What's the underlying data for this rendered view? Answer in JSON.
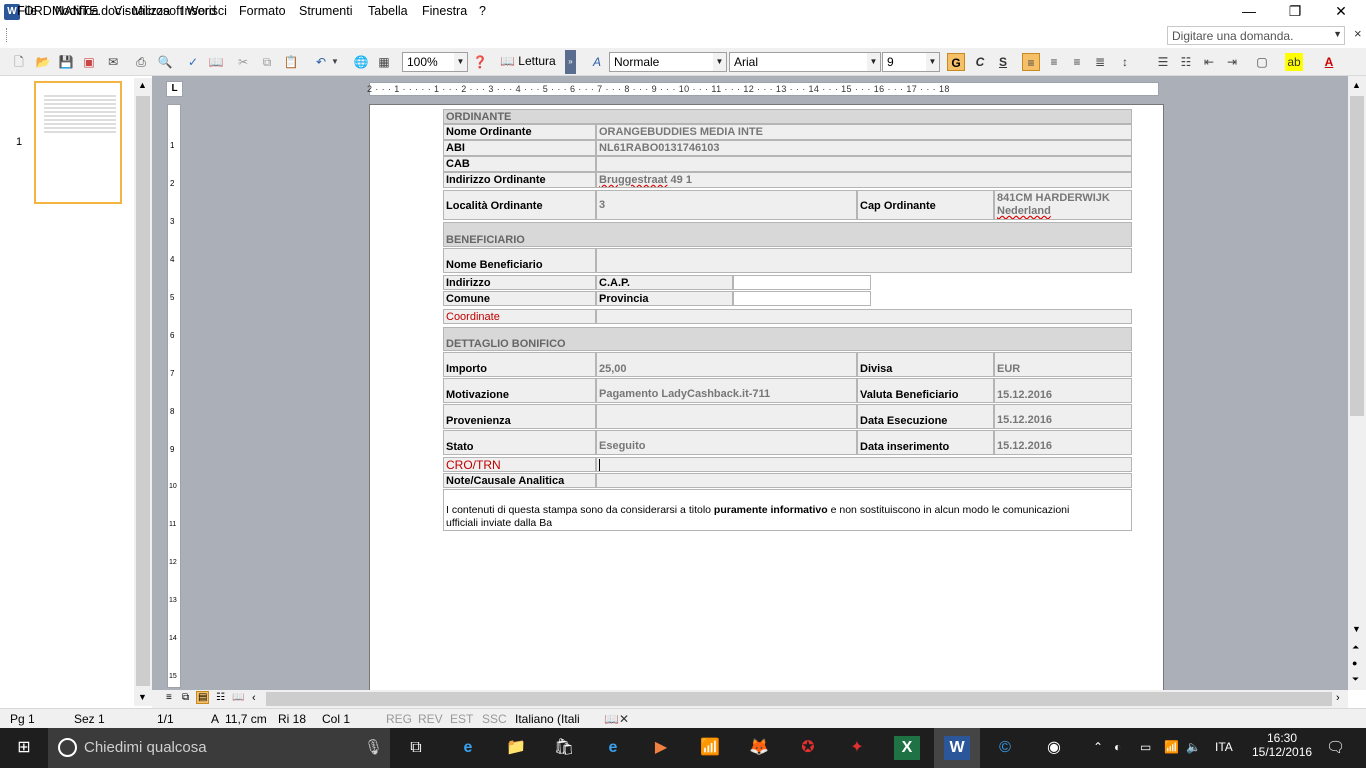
{
  "window": {
    "title": "ORDINANTE.doc - Microsoft Word",
    "icon_letter": "W",
    "minimize": "—",
    "restore": "❐",
    "close": "✕"
  },
  "menu": {
    "items": [
      "File",
      "Modifica",
      "Visualizza",
      "Inserisci",
      "Formato",
      "Strumenti",
      "Tabella",
      "Finestra",
      "?"
    ],
    "ask_placeholder": "Digitare una domanda.",
    "close_doc": "×"
  },
  "toolbar": {
    "zoom": "100%",
    "reading": "Lettura",
    "style": "Normale",
    "font": "Arial",
    "size": "9",
    "bold": "G",
    "italic": "C",
    "underline": "S"
  },
  "ruler": {
    "marks": "2 · · · 1 · · · · · 1 · · · 2 · · · 3 · · · 4 · · · 5 · · · 6 · · · 7 · · · 8 · · · 9 · · · 10 · · · 11 · · · 12 · · · 13 · · · 14 · · · 15 · · · 16 · · · 17 · · · 18",
    "tab_selector": "L",
    "vertical_marks": [
      "1",
      "1",
      "2",
      "3",
      "4",
      "5",
      "6",
      "7",
      "8",
      "9",
      "10",
      "11",
      "12",
      "13",
      "14",
      "15"
    ]
  },
  "thumbnails": {
    "page_number": "1"
  },
  "document": {
    "ordinante_header": "ORDINANTE",
    "nome_ordinante_label": "Nome Ordinante",
    "nome_ordinante": "ORANGEBUDDIES MEDIA INTE",
    "abi_label": "ABI",
    "abi": "NL61RABO0131746103",
    "cab_label": "CAB",
    "cab": "",
    "indirizzo_ordinante_label": "Indirizzo Ordinante",
    "indirizzo_ordinante_1": "Bruggestraat",
    "indirizzo_ordinante_2": " 49 1",
    "localita_label": "Località Ordinante",
    "localita": "3",
    "cap_ordinante_label": "Cap Ordinante",
    "cap_ordinante_1": "841CM HARDERWIJK",
    "cap_ordinante_2": "Nederland",
    "beneficiario_header": "BENEFICIARIO",
    "nome_beneficiario_label": "Nome Beneficiario",
    "nome_beneficiario": "",
    "indirizzo_label": "Indirizzo",
    "cap_label": "C.A.P.",
    "comune_label": "Comune",
    "provincia_label": "Provincia",
    "coordinate_label": "Coordinate",
    "coordinate": "",
    "dettaglio_header": "DETTAGLIO BONIFICO",
    "importo_label": "Importo",
    "importo": "25,00",
    "divisa_label": "Divisa",
    "divisa": "EUR",
    "motivazione_label": "Motivazione",
    "motivazione": "Pagamento LadyCashback.it-711",
    "valuta_label": "Valuta Beneficiario",
    "valuta": "15.12.2016",
    "provenienza_label": "Provenienza",
    "provenienza": "",
    "data_esecuzione_label": "Data Esecuzione",
    "data_esecuzione": "15.12.2016",
    "stato_label": "Stato",
    "stato": "Eseguito",
    "data_inserimento_label": "Data inserimento",
    "data_inserimento": "15.12.2016",
    "cro_label": "CRO/TRN",
    "cro": "",
    "note_label": "Note/Causale Analitica",
    "note": "",
    "disclaimer_1": "I contenuti di questa stampa sono da considerarsi a titolo ",
    "disclaimer_bold": "puramente informativo",
    "disclaimer_2": " e non sostituiscono in alcun modo le comunicazioni",
    "disclaimer_3": "ufficiali inviate dalla Ba"
  },
  "status": {
    "page": "Pg 1",
    "section": "Sez 1",
    "pages": "1/1",
    "position": "A  11,7 cm",
    "line": "Ri 18",
    "column": "Col 1",
    "reg": "REG",
    "rev": "REV",
    "est": "EST",
    "ssc": "SSC",
    "language": "Italiano (Itali"
  },
  "taskbar": {
    "search_placeholder": "Chiedimi qualcosa",
    "language": "ITA",
    "time": "16:30",
    "date": "15/12/2016"
  },
  "colors": {
    "accent_red": "#c00000",
    "cell_bg": "#efefef",
    "header_bg": "#d8d8d8",
    "taskbar": "#1e1e1e",
    "page_bg": "#abafb8"
  }
}
